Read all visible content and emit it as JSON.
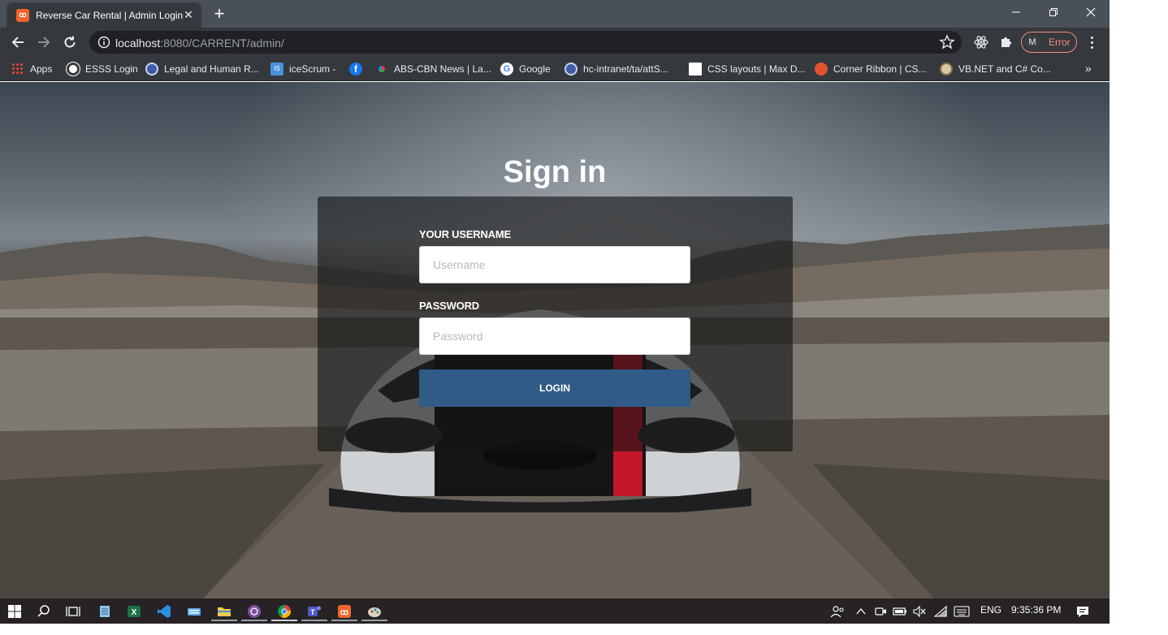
{
  "browser": {
    "tab": {
      "title": "Reverse Car Rental | Admin Login",
      "favicon": "xampp-icon",
      "favicon_color": "#f0642d"
    },
    "omnibox": {
      "url_host": "localhost",
      "url_rest": ":8080/CARRENT/admin/"
    },
    "profile": {
      "initial": "M",
      "status": "Error",
      "status_color": "#f28b82"
    },
    "bookmarks": [
      {
        "label": "Apps",
        "icon": "apps-grid-icon"
      },
      {
        "label": "ESSS Login",
        "icon": "globe-icon"
      },
      {
        "label": "Legal and Human R...",
        "icon": "seal-icon"
      },
      {
        "label": "iceScrum -",
        "icon": "icescrum-icon"
      },
      {
        "label": "",
        "icon": "facebook-icon"
      },
      {
        "label": "ABS-CBN News | La...",
        "icon": "abs-cbn-icon"
      },
      {
        "label": "Google",
        "icon": "google-icon"
      },
      {
        "label": "hc-intranet/ta/attS...",
        "icon": "seal-icon"
      },
      {
        "label": "CSS layouts | Max D...",
        "icon": "css-layouts-icon"
      },
      {
        "label": "Corner Ribbon | CS...",
        "icon": "codepen-icon"
      },
      {
        "label": "VB.NET and C# Co...",
        "icon": "converter-icon"
      }
    ],
    "more": "»"
  },
  "login": {
    "heading": "Sign in",
    "username_label": "YOUR USERNAME",
    "username_placeholder": "Username",
    "password_label": "PASSWORD",
    "password_placeholder": "Password",
    "button_label": "LOGIN"
  },
  "taskbar": {
    "language": "ENG",
    "time": "9:35:36 PM",
    "apps": [
      "windows-start-icon",
      "search-icon",
      "task-view-icon",
      "notepad-icon",
      "excel-icon",
      "vscode-icon",
      "keyboard-icon",
      "file-explorer-icon",
      "viber-icon",
      "chrome-icon",
      "teams-icon",
      "xampp-icon",
      "paint-icon"
    ]
  },
  "colors": {
    "accent_button": "#2f5b86",
    "panel_overlay": "rgba(20,20,20,0.62)"
  }
}
